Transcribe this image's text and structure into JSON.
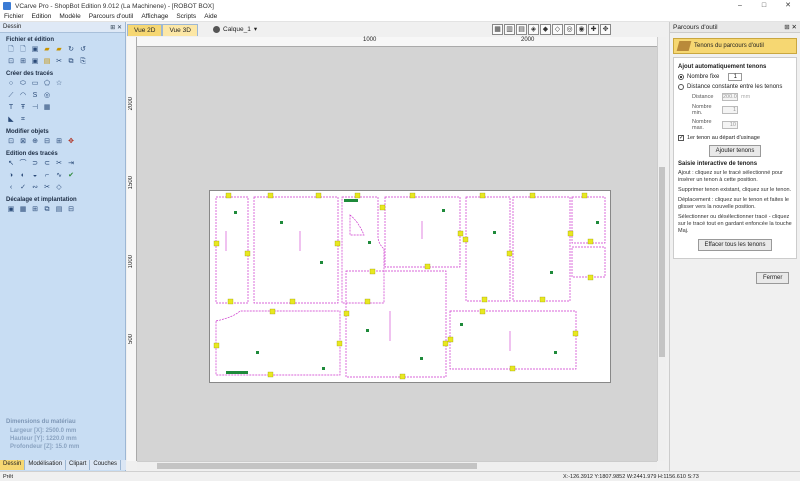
{
  "window": {
    "title": "VCarve Pro - ShopBot Edition 9.012 (La Machinene) - [ROBOT BOX]"
  },
  "window_controls": {
    "minimize": "–",
    "maximize": "□",
    "close": "✕"
  },
  "menu": [
    "Fichier",
    "Edition",
    "Modèle",
    "Parcours d'outil",
    "Affichage",
    "Scripts",
    "Aide"
  ],
  "left_panel": {
    "title": "Dessin",
    "pin": "⊞ ✕",
    "sections": [
      {
        "title": "Fichier et édition",
        "icons": [
          "new-file-icon",
          "new-file-icon",
          "save-icon",
          "open-folder-icon",
          "folder-icon",
          "redo-icon",
          "undo-icon",
          "new-file-icon",
          "save-icon",
          "import-icon",
          "export-icon",
          "job-setup-icon"
        ]
      },
      {
        "title": "Créer des tracés",
        "icons": [
          "circle-icon",
          "ellipse-icon",
          "rectangle-icon",
          "polygon-icon",
          "star-icon",
          "line-icon",
          "arc-icon",
          "curve-icon",
          "spiral-icon",
          "text-icon",
          "text-on-path-icon",
          "dimension-icon",
          "table-icon",
          "shape-icon",
          "cut-icon"
        ]
      },
      {
        "title": "Modifier objets",
        "icons": [
          "move-icon",
          "scale-icon",
          "rotate-icon",
          "mirror-icon",
          "align-icon",
          "center-icon"
        ]
      },
      {
        "title": "Edition des tracés",
        "icons": [
          "node-edit-icon",
          "curve-fit-icon",
          "join-icon",
          "close-vector-icon",
          "trim-icon",
          "extend-icon",
          "fillet-icon",
          "smooth-icon",
          "weld-icon",
          "subtract-icon",
          "intersect-icon",
          "check-icon",
          "fit-icon",
          "chain-icon",
          "cut-vector-icon",
          "break-icon"
        ]
      },
      {
        "title": "Décalage et implantation",
        "icons": [
          "offset-icon",
          "nesting-icon",
          "array-icon",
          "copy-icon",
          "layout-icon",
          "grid-icon"
        ]
      }
    ],
    "material": {
      "title": "Dimensions du matériau",
      "rows": [
        "Largeur [X]: 2500.0 mm",
        "Hauteur [Y]: 1220.0 mm",
        "Profondeur [Z]: 15.0 mm"
      ]
    },
    "tabs": [
      "Dessin",
      "Modélisation",
      "Clipart",
      "Couches"
    ]
  },
  "view_tabs": [
    "Vue 2D",
    "Vue 3D"
  ],
  "layer": "Calque_1",
  "toolbar": [
    "▦",
    "▥",
    "▤",
    "◈",
    "◆",
    "◇",
    "◎",
    "◉",
    "✚",
    "✥"
  ],
  "rulers": {
    "top": [
      "1000",
      "2000"
    ],
    "left": [
      "2000",
      "1500",
      "1000",
      "500"
    ]
  },
  "right_panel": {
    "title": "Parcours d'outil",
    "controls": "⊞ ✕",
    "tool_name": "Tenons du parcours d'outil",
    "auto_section": "Ajout automatiquement tenons",
    "opt_fixed": "Nombre fixe",
    "fixed_count": "1",
    "opt_distance": "Distance constante entre les tenons",
    "distance_label": "Distance",
    "distance_value": "200.0",
    "distance_unit": "mm",
    "min_label": "Nombre min.",
    "min_value": "1",
    "max_label": "Nombre max.",
    "max_value": "10",
    "first_tab_check": "1er tenon au départ d'usinage",
    "add_button": "Ajouter tenons",
    "interactive_section": "Saisie interactive de tenons",
    "help": [
      "Ajout : cliquez sur le tracé sélectionné pour insérer un tenon à cette position.",
      "Supprimer tenon existant, cliquez sur le tenon.",
      "Déplacement : cliquez sur le tenon et faites le glisser vers la nouvelle position.",
      "Sélectionner ou désélectionner tracé - cliquez sur le tracé tout en gardant enfoncée la touche Maj."
    ],
    "clear_button": "Effacer tous les tenons",
    "close_button": "Fermer"
  },
  "status": {
    "ready": "Prêt",
    "coords": "X:-126.3912 Y:1807.9852   W:2441.979  H:1156.610  S:73"
  },
  "colors": {
    "panel_blue": "#c8ddf3",
    "tab_yellow": "#f6d772",
    "toolpath_magenta": "#cc33cc",
    "tab_marker_yellow": "#e8e820",
    "tab_marker_green": "#1e8a3a"
  }
}
